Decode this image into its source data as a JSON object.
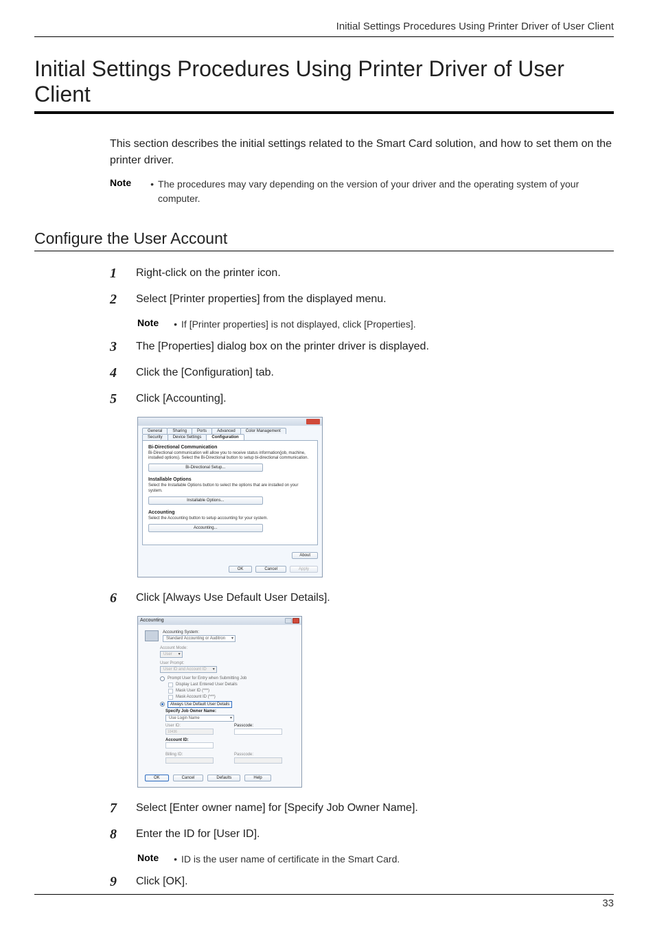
{
  "running_header": "Initial Settings Procedures Using Printer Driver of User Client",
  "h1": "Initial Settings Procedures Using Printer Driver of User Client",
  "intro": "This section describes the initial settings related to the Smart Card solution, and how to set them on the printer driver.",
  "note_label": "Note",
  "note1": "The procedures may vary depending on the version of your driver and the operating system of your computer.",
  "h2": "Configure the User Account",
  "steps": {
    "1": "Right-click on the printer icon.",
    "2": "Select [Printer properties] from the displayed menu.",
    "3": "The [Properties] dialog box on the printer driver is displayed.",
    "4": "Click the [Configuration] tab.",
    "5": "Click [Accounting].",
    "6": "Click [Always Use Default User Details].",
    "7": "Select [Enter owner name] for [Specify Job Owner Name].",
    "8": "Enter the ID for [User ID].",
    "9": "Click [OK]."
  },
  "note2": "If [Printer properties] is not displayed, click [Properties].",
  "note3": "ID is the user name of certificate in the Smart Card.",
  "dialog1": {
    "tabs_row1": [
      "General",
      "Sharing",
      "Ports",
      "Advanced",
      "Color Management"
    ],
    "tabs_row2": [
      "Security",
      "Device Settings",
      "Configuration"
    ],
    "sec1_title": "Bi-Directional Communication",
    "sec1_text": "Bi-Directional communication will allow you to receive status information(job, machine, installed options). Select the Bi-Directional button to setup bi-directional communication.",
    "sec1_btn": "Bi-Directional Setup...",
    "sec2_title": "Installable Options",
    "sec2_text": "Select the Installable Options button to select the options that are installed on your system.",
    "sec2_btn": "Installable Options...",
    "sec3_title": "Accounting",
    "sec3_text": "Select the Accounting button to setup accounting for your system.",
    "sec3_btn": "Accounting...",
    "about": "About",
    "ok": "OK",
    "cancel": "Cancel",
    "apply": "Apply"
  },
  "dialog2": {
    "title": "Accounting",
    "accounting_system_label": "Accounting System:",
    "accounting_system_value": "Standard Accounting or Auditron",
    "account_mode_label": "Account Mode:",
    "account_mode_value": "User",
    "user_prompt_label": "User Prompt:",
    "user_prompt_value": "User ID and Account ID",
    "radio1": "Prompt User for Entry when Submitting Job",
    "check1": "Display Last Entered User Details",
    "check2": "Mask User ID (***)",
    "check3": "Mask Account ID (***)",
    "radio2": "Always Use Default User Details",
    "owner_label": "Specify Job Owner Name:",
    "owner_value": "Use Login Name",
    "user_id_label": "User ID:",
    "user_id_value": "10436",
    "passcode_label": "Passcode:",
    "account_id_label": "Account ID:",
    "billing_id_label": "Billing ID:",
    "passcode2_label": "Passcode:",
    "ok": "OK",
    "cancel": "Cancel",
    "defaults": "Defaults",
    "help": "Help"
  },
  "page_number": "33"
}
